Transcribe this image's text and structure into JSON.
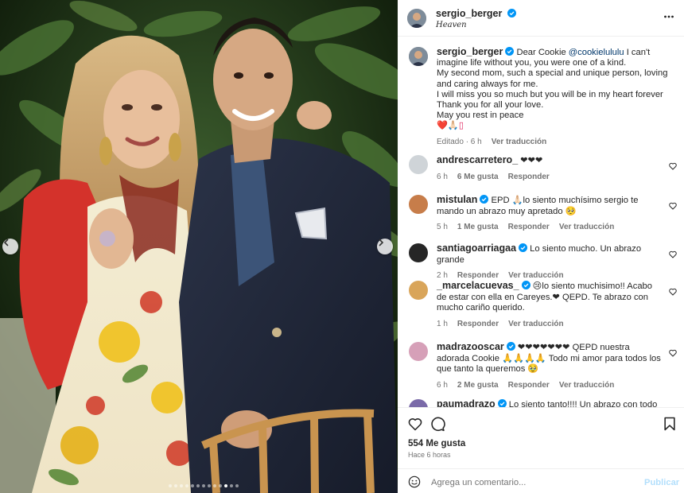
{
  "post": {
    "username": "sergio_berger",
    "subtitle": "Heaven",
    "image_count": 13,
    "active_image": 10
  },
  "caption": {
    "username": "sergio_berger",
    "text_before_mention": "Dear Cookie ",
    "mention": "@cookielululu",
    "text_after_mention": " I can't imagine life without you, you were one of a kind.",
    "lines": [
      "My second mom, such a special and unique person, loving and caring always for me.",
      "I will miss you so much but you will be in my heart forever",
      "Thank you for all your love.",
      "May you rest in peace",
      "❤️🙏🏻▯"
    ],
    "edited": "Editado · 6 h",
    "see_translation": "Ver traducción"
  },
  "comments": [
    {
      "username": "andrescarretero_",
      "verified": false,
      "text": "❤❤❤",
      "time": "6 h",
      "likes": "6 Me gusta",
      "reply": "Responder",
      "translate": ""
    },
    {
      "username": "mistulan",
      "verified": true,
      "text": "EPD 🙏🏻lo siento muchísimo sergio te mando un abrazo muy apretado 🥺",
      "time": "5 h",
      "likes": "1 Me gusta",
      "reply": "Responder",
      "translate": "Ver traducción"
    },
    {
      "username": "santiagoarriagaa",
      "verified": true,
      "text": "Lo siento mucho. Un abrazo grande",
      "time": "2 h",
      "likes": "",
      "reply": "Responder",
      "translate": "Ver traducción"
    },
    {
      "username": "_marcelacuevas_",
      "verified": true,
      "text": "😢lo siento muchisimo!! Acabo de estar con ella en Careyes.❤ QEPD. Te abrazo con mucho cariño querido.",
      "time": "1 h",
      "likes": "",
      "reply": "Responder",
      "translate": "Ver traducción"
    },
    {
      "username": "madrazooscar",
      "verified": true,
      "text": "❤❤❤❤❤❤❤ QEPD nuestra adorada Cookie 🙏🙏🙏🙏 Todo mi amor para todos los que tanto la queremos 🥹",
      "time": "6 h",
      "likes": "2 Me gusta",
      "reply": "Responder",
      "translate": "Ver traducción"
    },
    {
      "username": "paumadrazo",
      "verified": true,
      "text": "Lo siento tanto!!!! Un abrazo con todo mi",
      "time": "",
      "likes": "",
      "reply": "",
      "translate": ""
    }
  ],
  "footer": {
    "likes": "554 Me gusta",
    "time": "Hace 6 horas",
    "comment_placeholder": "Agrega un comentario...",
    "publish": "Publicar"
  },
  "colors": {
    "verified": "#0095f6",
    "heart_emoji": "#e0245e",
    "link": "#00376b",
    "publish_disabled": "#b2dffc",
    "muted": "#737373"
  },
  "icons": [
    "chevron-left-icon",
    "chevron-right-icon",
    "more-icon",
    "verified-icon",
    "heart-outline-icon",
    "comment-icon",
    "bookmark-icon",
    "emoji-icon"
  ]
}
